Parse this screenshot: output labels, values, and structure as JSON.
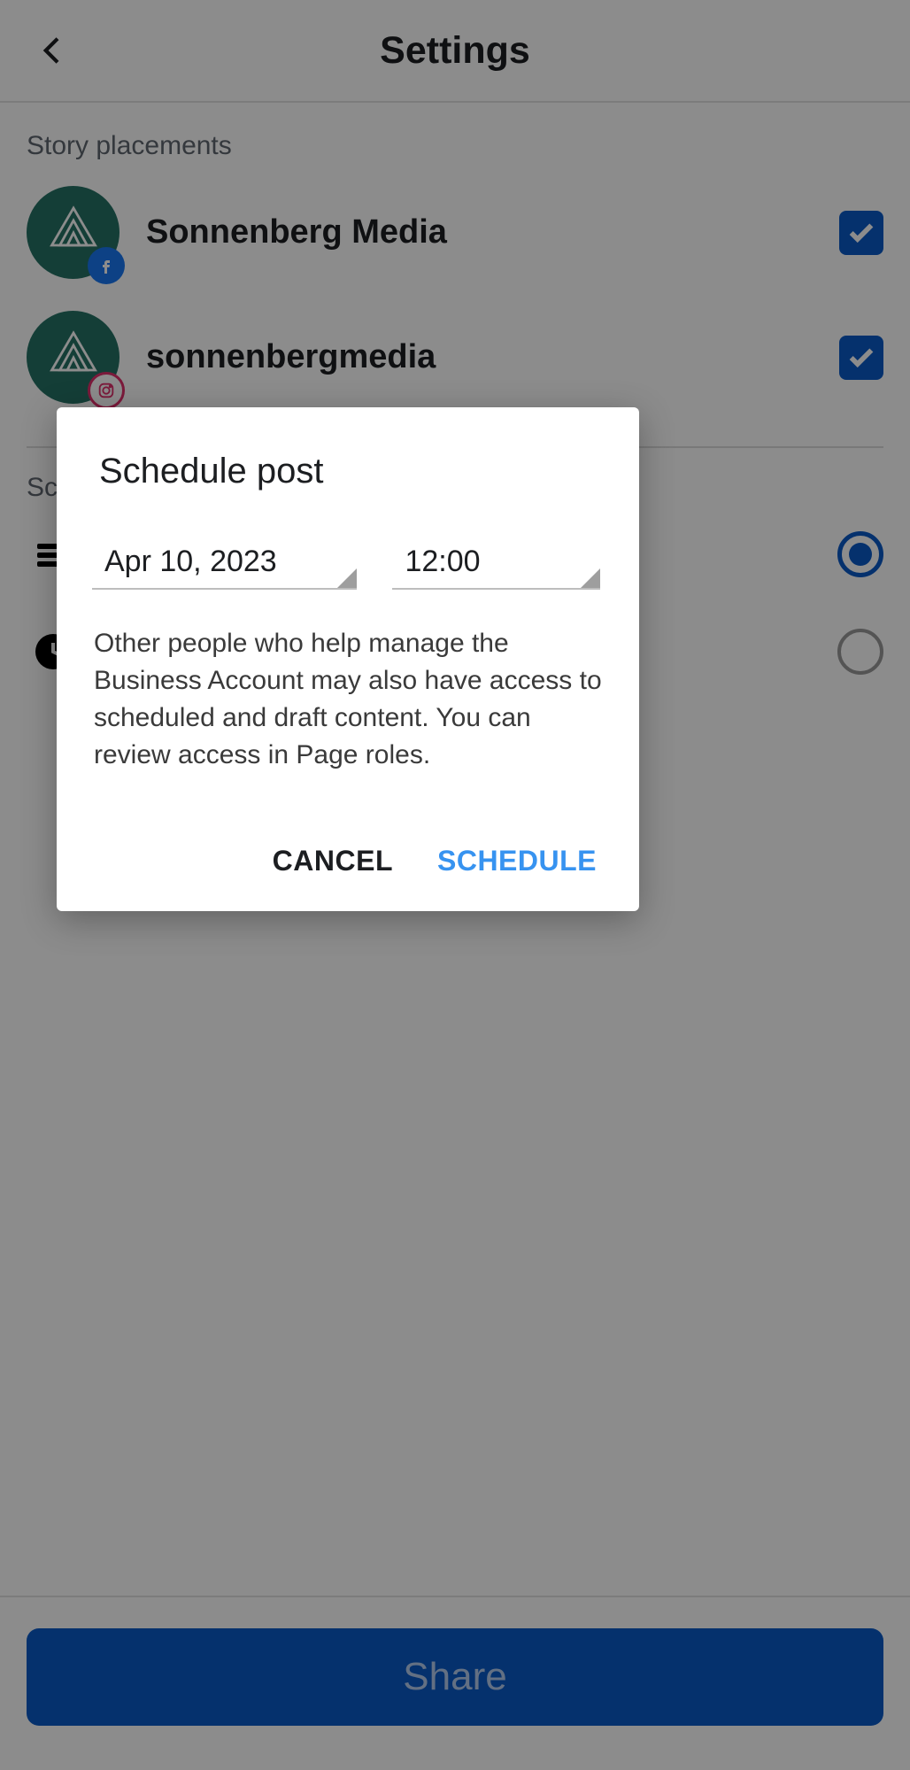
{
  "header": {
    "title": "Settings"
  },
  "section_story_placements": "Story placements",
  "placements": [
    {
      "name": "Sonnenberg Media",
      "platform": "facebook",
      "checked": true
    },
    {
      "name": "sonnenbergmedia",
      "platform": "instagram",
      "checked": true
    }
  ],
  "schedule_section_label_partial": "Sc",
  "footer": {
    "share_label": "Share"
  },
  "dialog": {
    "title": "Schedule post",
    "date": "Apr 10, 2023",
    "time": "12:00",
    "body": "Other people who help manage the  Business Account may also have access to scheduled and draft content. You can review access in Page roles.",
    "cancel_label": "CANCEL",
    "schedule_label": "SCHEDULE"
  },
  "colors": {
    "primary": "#0a59c7",
    "accent_link": "#3793f0",
    "avatar_bg": "#267265"
  }
}
